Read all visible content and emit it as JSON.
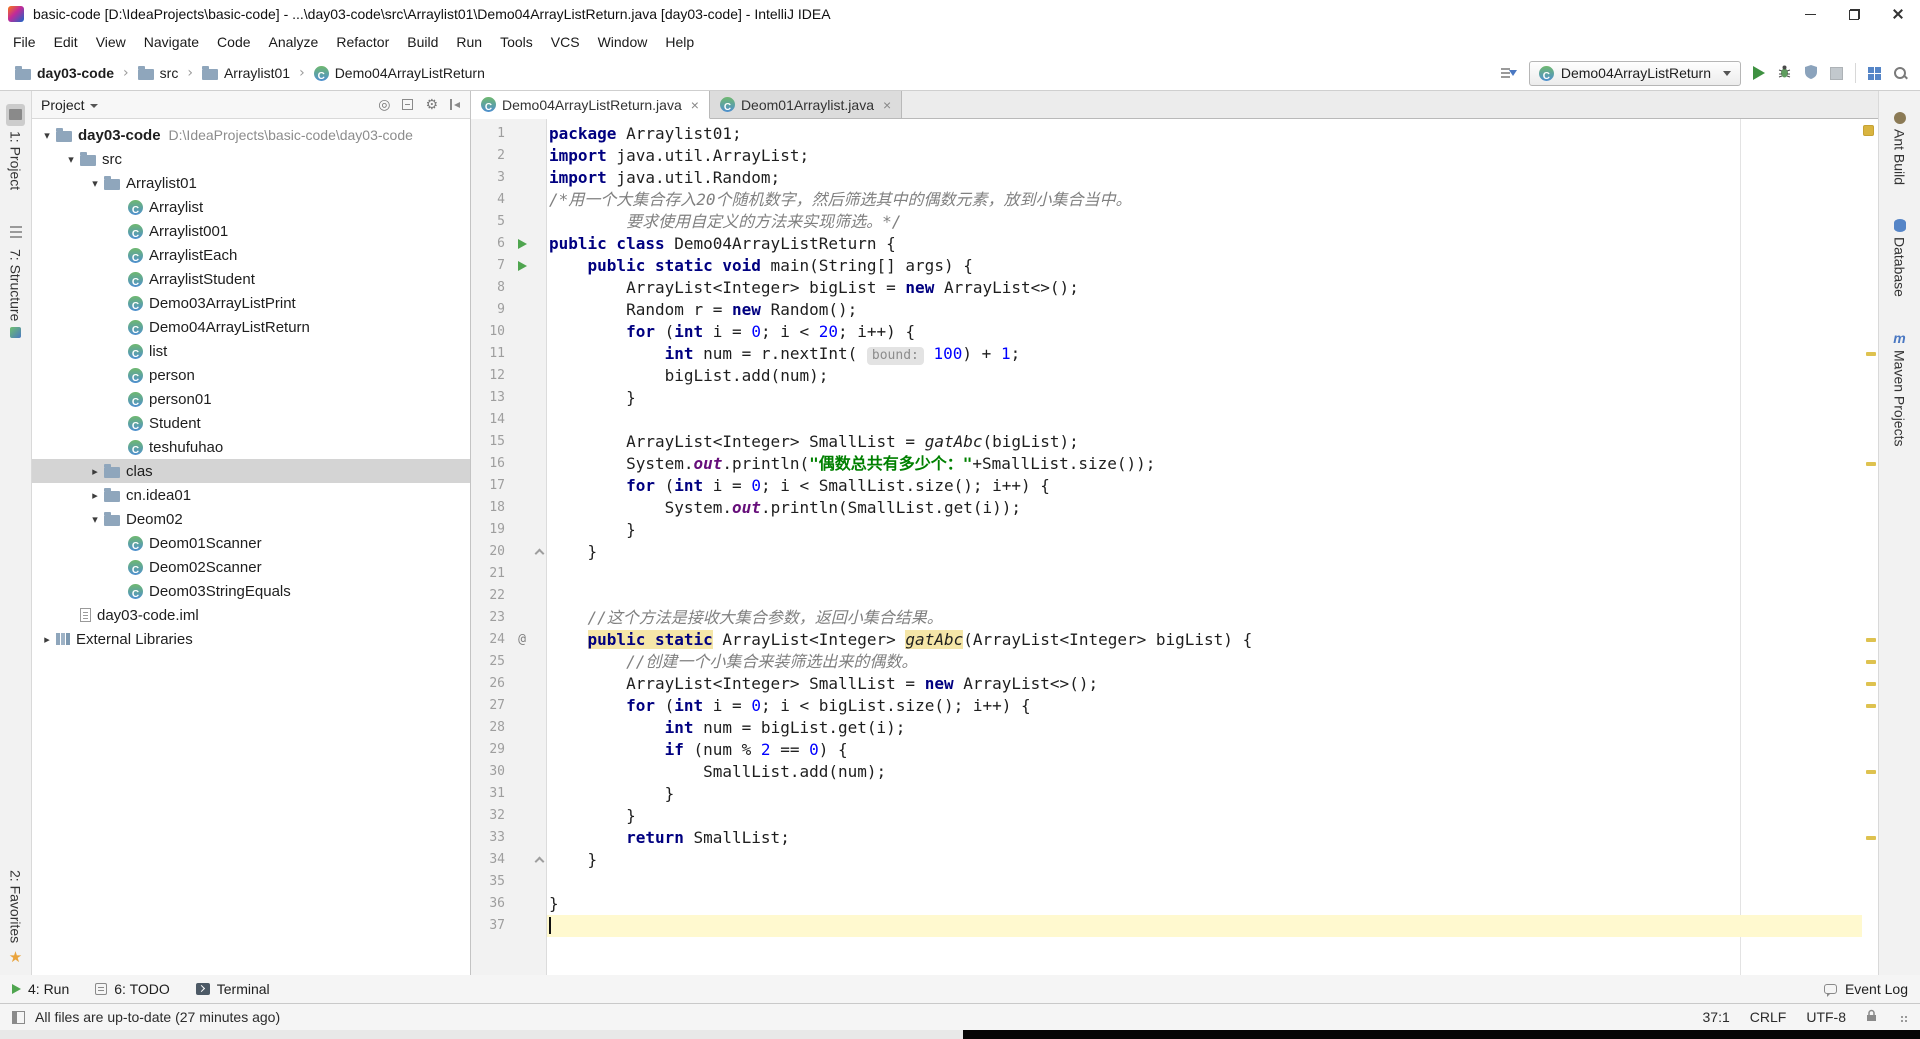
{
  "window": {
    "title": "basic-code [D:\\IdeaProjects\\basic-code] - ...\\day03-code\\src\\Arraylist01\\Demo04ArrayListReturn.java [day03-code] - IntelliJ IDEA"
  },
  "glyphs": {
    "chevron_down": "▾",
    "chevron_right": "▸",
    "crumb_sep": "›",
    "close": "×",
    "star": "★",
    "gear": "⚙",
    "locate": "◎",
    "at": "@",
    "maven_m": "m"
  },
  "colors": {
    "keyword": "#000080",
    "string": "#008000",
    "number": "#0000FF",
    "comment": "#808080",
    "static_field": "#660E7A",
    "tree_selection": "#D4D4D4",
    "caret_line": "#FFF9CF",
    "warning_stripe": "#DEC24F",
    "run_green": "#4FA54F"
  },
  "menu": [
    "File",
    "Edit",
    "View",
    "Navigate",
    "Code",
    "Analyze",
    "Refactor",
    "Build",
    "Run",
    "Tools",
    "VCS",
    "Window",
    "Help"
  ],
  "toolbar": {
    "breadcrumbs": [
      {
        "label": "day03-code",
        "icon": "folder"
      },
      {
        "label": "src",
        "icon": "folder"
      },
      {
        "label": "Arraylist01",
        "icon": "folder"
      },
      {
        "label": "Demo04ArrayListReturn",
        "icon": "class"
      }
    ],
    "run_config": "Demo04ArrayListReturn"
  },
  "left_stripe": {
    "project": "1: Project",
    "structure": "7: Structure",
    "favorites": "2: Favorites"
  },
  "right_stripe": {
    "ant_build": "Ant Build",
    "database": "Database",
    "maven_projects": "Maven Projects"
  },
  "project": {
    "header": "Project",
    "tree": [
      {
        "label": "day03-code",
        "icon": "project",
        "level": 0,
        "chevron": "down",
        "bold": true,
        "hint": "D:\\IdeaProjects\\basic-code\\day03-code"
      },
      {
        "label": "src",
        "icon": "folder",
        "level": 1,
        "chevron": "down"
      },
      {
        "label": "Arraylist01",
        "icon": "folder",
        "level": 2,
        "chevron": "down"
      },
      {
        "label": "Arraylist",
        "icon": "class",
        "level": 3
      },
      {
        "label": "Arraylist001",
        "icon": "class",
        "level": 3
      },
      {
        "label": "ArraylistEach",
        "icon": "class",
        "level": 3
      },
      {
        "label": "ArraylistStudent",
        "icon": "class",
        "level": 3
      },
      {
        "label": "Demo03ArrayListPrint",
        "icon": "class",
        "level": 3
      },
      {
        "label": "Demo04ArrayListReturn",
        "icon": "class",
        "level": 3
      },
      {
        "label": "list",
        "icon": "class",
        "level": 3
      },
      {
        "label": "person",
        "icon": "class",
        "level": 3
      },
      {
        "label": "person01",
        "icon": "class",
        "level": 3
      },
      {
        "label": "Student",
        "icon": "class",
        "level": 3
      },
      {
        "label": "teshufuhao",
        "icon": "class",
        "level": 3
      },
      {
        "label": "clas",
        "icon": "folder",
        "level": 2,
        "chevron": "right",
        "selected": true
      },
      {
        "label": "cn.idea01",
        "icon": "folder",
        "level": 2,
        "chevron": "right"
      },
      {
        "label": "Deom02",
        "icon": "folder",
        "level": 2,
        "chevron": "down"
      },
      {
        "label": "Deom01Scanner",
        "icon": "class",
        "level": 3
      },
      {
        "label": "Deom02Scanner",
        "icon": "class",
        "level": 3
      },
      {
        "label": "Deom03StringEquals",
        "icon": "class",
        "level": 3
      },
      {
        "label": "day03-code.iml",
        "icon": "file",
        "level": 1
      },
      {
        "label": "External Libraries",
        "icon": "library",
        "level": 0,
        "chevron": "right"
      }
    ]
  },
  "editor": {
    "tabs": [
      {
        "label": "Demo04ArrayListReturn.java",
        "active": true
      },
      {
        "label": "Deom01Arraylist.java",
        "active": false
      }
    ],
    "warning_lines": [
      11,
      16,
      24,
      25,
      26,
      27,
      30,
      33
    ],
    "lines": [
      {
        "n": 1,
        "t": [
          [
            "kw",
            "package"
          ],
          [
            "pl",
            " Arraylist01;"
          ]
        ]
      },
      {
        "n": 2,
        "t": [
          [
            "kw",
            "import"
          ],
          [
            "pl",
            " java.util.ArrayList;"
          ]
        ]
      },
      {
        "n": 3,
        "t": [
          [
            "kw",
            "import"
          ],
          [
            "pl",
            " java.util.Random;"
          ]
        ]
      },
      {
        "n": 4,
        "t": [
          [
            "cmt",
            "/*用一个大集合存入20个随机数字，然后筛选其中的偶数元素，放到小集合当中。"
          ]
        ]
      },
      {
        "n": 5,
        "t": [
          [
            "cmt",
            "        要求使用自定义的方法来实现筛选。*/"
          ]
        ]
      },
      {
        "n": 6,
        "g": "run",
        "t": [
          [
            "kw",
            "public class"
          ],
          [
            "pl",
            " Demo04ArrayListReturn {"
          ]
        ]
      },
      {
        "n": 7,
        "g": "run",
        "t": [
          [
            "pl",
            "    "
          ],
          [
            "kw",
            "public static void"
          ],
          [
            "pl",
            " main(String[] args) {"
          ]
        ]
      },
      {
        "n": 8,
        "t": [
          [
            "pl",
            "        ArrayList<Integer> bigList = "
          ],
          [
            "kw",
            "new"
          ],
          [
            "pl",
            " ArrayList<>();"
          ]
        ]
      },
      {
        "n": 9,
        "t": [
          [
            "pl",
            "        Random r = "
          ],
          [
            "kw",
            "new"
          ],
          [
            "pl",
            " Random();"
          ]
        ]
      },
      {
        "n": 10,
        "t": [
          [
            "pl",
            "        "
          ],
          [
            "kw",
            "for"
          ],
          [
            "pl",
            " ("
          ],
          [
            "kw",
            "int"
          ],
          [
            "pl",
            " i = "
          ],
          [
            "num",
            "0"
          ],
          [
            "pl",
            "; i < "
          ],
          [
            "num",
            "20"
          ],
          [
            "pl",
            "; i++) {"
          ]
        ]
      },
      {
        "n": 11,
        "t": [
          [
            "pl",
            "            "
          ],
          [
            "kw",
            "int"
          ],
          [
            "pl",
            " num = r.nextInt( "
          ],
          [
            "hint",
            "bound:"
          ],
          [
            "pl",
            " "
          ],
          [
            "num",
            "100"
          ],
          [
            "pl",
            ") + "
          ],
          [
            "num",
            "1"
          ],
          [
            "pl",
            ";"
          ]
        ]
      },
      {
        "n": 12,
        "t": [
          [
            "pl",
            "            bigList.add(num);"
          ]
        ]
      },
      {
        "n": 13,
        "t": [
          [
            "pl",
            "        }"
          ]
        ]
      },
      {
        "n": 14,
        "t": []
      },
      {
        "n": 15,
        "t": [
          [
            "pl",
            "        ArrayList<Integer> SmallList = "
          ],
          [
            "it",
            "gatAbc"
          ],
          [
            "pl",
            "(bigList);"
          ]
        ]
      },
      {
        "n": 16,
        "t": [
          [
            "pl",
            "        System."
          ],
          [
            "so",
            "out"
          ],
          [
            "pl",
            ".println("
          ],
          [
            "str",
            "\"偶数总共有多少个：\""
          ],
          [
            "pl",
            "+SmallList.size());"
          ]
        ]
      },
      {
        "n": 17,
        "t": [
          [
            "pl",
            "        "
          ],
          [
            "kw",
            "for"
          ],
          [
            "pl",
            " ("
          ],
          [
            "kw",
            "int"
          ],
          [
            "pl",
            " i = "
          ],
          [
            "num",
            "0"
          ],
          [
            "pl",
            "; i < SmallList.size(); i++) {"
          ]
        ]
      },
      {
        "n": 18,
        "t": [
          [
            "pl",
            "            System."
          ],
          [
            "so",
            "out"
          ],
          [
            "pl",
            ".println(SmallList.get(i));"
          ]
        ]
      },
      {
        "n": 19,
        "t": [
          [
            "pl",
            "        }"
          ]
        ]
      },
      {
        "n": 20,
        "f": "end",
        "t": [
          [
            "pl",
            "    }"
          ]
        ]
      },
      {
        "n": 21,
        "t": []
      },
      {
        "n": 22,
        "t": []
      },
      {
        "n": 23,
        "t": [
          [
            "pl",
            "    "
          ],
          [
            "cmt",
            "//这个方法是接收大集合参数，返回小集合结果。"
          ]
        ]
      },
      {
        "n": 24,
        "g": "at",
        "t": [
          [
            "pl",
            "    "
          ],
          [
            "kwhl",
            "public static"
          ],
          [
            "pl",
            " ArrayList<Integer> "
          ],
          [
            "ithl",
            "gatAbc"
          ],
          [
            "pl",
            "(ArrayList<Integer> bigList) {"
          ]
        ]
      },
      {
        "n": 25,
        "t": [
          [
            "pl",
            "        "
          ],
          [
            "cmt",
            "//创建一个小集合来装筛选出来的偶数。"
          ]
        ]
      },
      {
        "n": 26,
        "t": [
          [
            "pl",
            "        ArrayList<Integer> SmallList = "
          ],
          [
            "kw",
            "new"
          ],
          [
            "pl",
            " ArrayList<>();"
          ]
        ]
      },
      {
        "n": 27,
        "t": [
          [
            "pl",
            "        "
          ],
          [
            "kw",
            "for"
          ],
          [
            "pl",
            " ("
          ],
          [
            "kw",
            "int"
          ],
          [
            "pl",
            " i = "
          ],
          [
            "num",
            "0"
          ],
          [
            "pl",
            "; i < bigList.size(); i++) {"
          ]
        ]
      },
      {
        "n": 28,
        "t": [
          [
            "pl",
            "            "
          ],
          [
            "kw",
            "int"
          ],
          [
            "pl",
            " num = bigList.get(i);"
          ]
        ]
      },
      {
        "n": 29,
        "t": [
          [
            "pl",
            "            "
          ],
          [
            "kw",
            "if"
          ],
          [
            "pl",
            " (num % "
          ],
          [
            "num",
            "2"
          ],
          [
            "pl",
            " == "
          ],
          [
            "num",
            "0"
          ],
          [
            "pl",
            ") {"
          ]
        ]
      },
      {
        "n": 30,
        "t": [
          [
            "pl",
            "                SmallList.add(num);"
          ]
        ]
      },
      {
        "n": 31,
        "t": [
          [
            "pl",
            "            }"
          ]
        ]
      },
      {
        "n": 32,
        "t": [
          [
            "pl",
            "        }"
          ]
        ]
      },
      {
        "n": 33,
        "t": [
          [
            "pl",
            "        "
          ],
          [
            "kw",
            "return"
          ],
          [
            "pl",
            " SmallList;"
          ]
        ]
      },
      {
        "n": 34,
        "f": "end",
        "t": [
          [
            "pl",
            "    }"
          ]
        ]
      },
      {
        "n": 35,
        "t": []
      },
      {
        "n": 36,
        "t": [
          [
            "pl",
            "}"
          ]
        ]
      },
      {
        "n": 37,
        "caret": true,
        "t": []
      }
    ]
  },
  "bottom_bar": {
    "run": "4: Run",
    "todo": "6: TODO",
    "terminal": "Terminal",
    "event_log": "Event Log"
  },
  "status_bar": {
    "message": "All files are up-to-date (27 minutes ago)",
    "caret_position": "37:1",
    "line_separator": "CRLF",
    "encoding": "UTF-8"
  }
}
